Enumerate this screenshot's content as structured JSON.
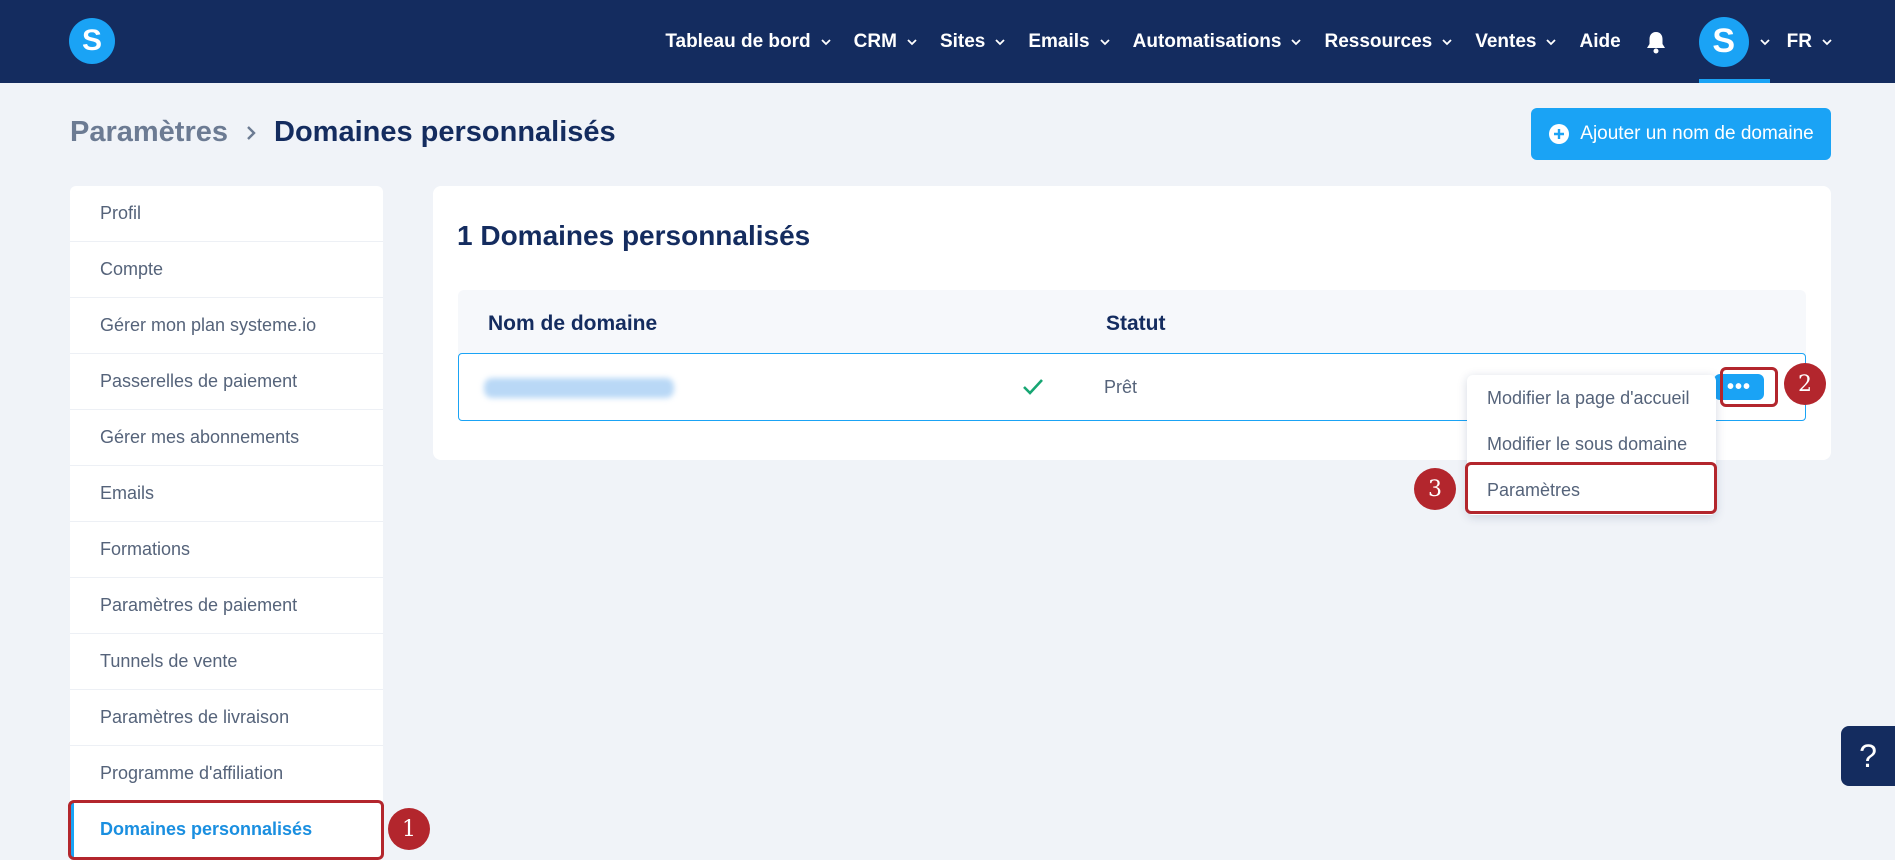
{
  "nav": {
    "logo_letter": "S",
    "items": [
      {
        "label": "Tableau de bord",
        "has_dropdown": true
      },
      {
        "label": "CRM",
        "has_dropdown": true
      },
      {
        "label": "Sites",
        "has_dropdown": true
      },
      {
        "label": "Emails",
        "has_dropdown": true
      },
      {
        "label": "Automatisations",
        "has_dropdown": true
      },
      {
        "label": "Ressources",
        "has_dropdown": true
      },
      {
        "label": "Ventes",
        "has_dropdown": true
      },
      {
        "label": "Aide",
        "has_dropdown": false
      }
    ],
    "avatar_letter": "S",
    "language": "FR"
  },
  "header": {
    "breadcrumb_parent": "Paramètres",
    "breadcrumb_current": "Domaines personnalisés",
    "add_button_label": "Ajouter un nom de domaine"
  },
  "sidebar": {
    "items": [
      {
        "label": "Profil"
      },
      {
        "label": "Compte"
      },
      {
        "label": "Gérer mon plan systeme.io"
      },
      {
        "label": "Passerelles de paiement"
      },
      {
        "label": "Gérer mes abonnements"
      },
      {
        "label": "Emails"
      },
      {
        "label": "Formations"
      },
      {
        "label": "Paramètres de paiement"
      },
      {
        "label": "Tunnels de vente"
      },
      {
        "label": "Paramètres de livraison"
      },
      {
        "label": "Programme d'affiliation"
      },
      {
        "label": "Domaines personnalisés",
        "active": true
      }
    ]
  },
  "main": {
    "title": "1 Domaines personnalisés",
    "columns": [
      "Nom de domaine",
      "Statut"
    ],
    "rows": [
      {
        "status": "Prêt"
      }
    ],
    "dropdown_items": [
      "Modifier la page d'accueil",
      "Modifier le sous domaine",
      "Paramètres"
    ]
  },
  "annotations": [
    "1",
    "2",
    "3"
  ],
  "help_label": "?",
  "colors": {
    "topbar": "#142c5f",
    "accent": "#1aa3f5",
    "highlight": "#b3262d",
    "success": "#17a673"
  }
}
